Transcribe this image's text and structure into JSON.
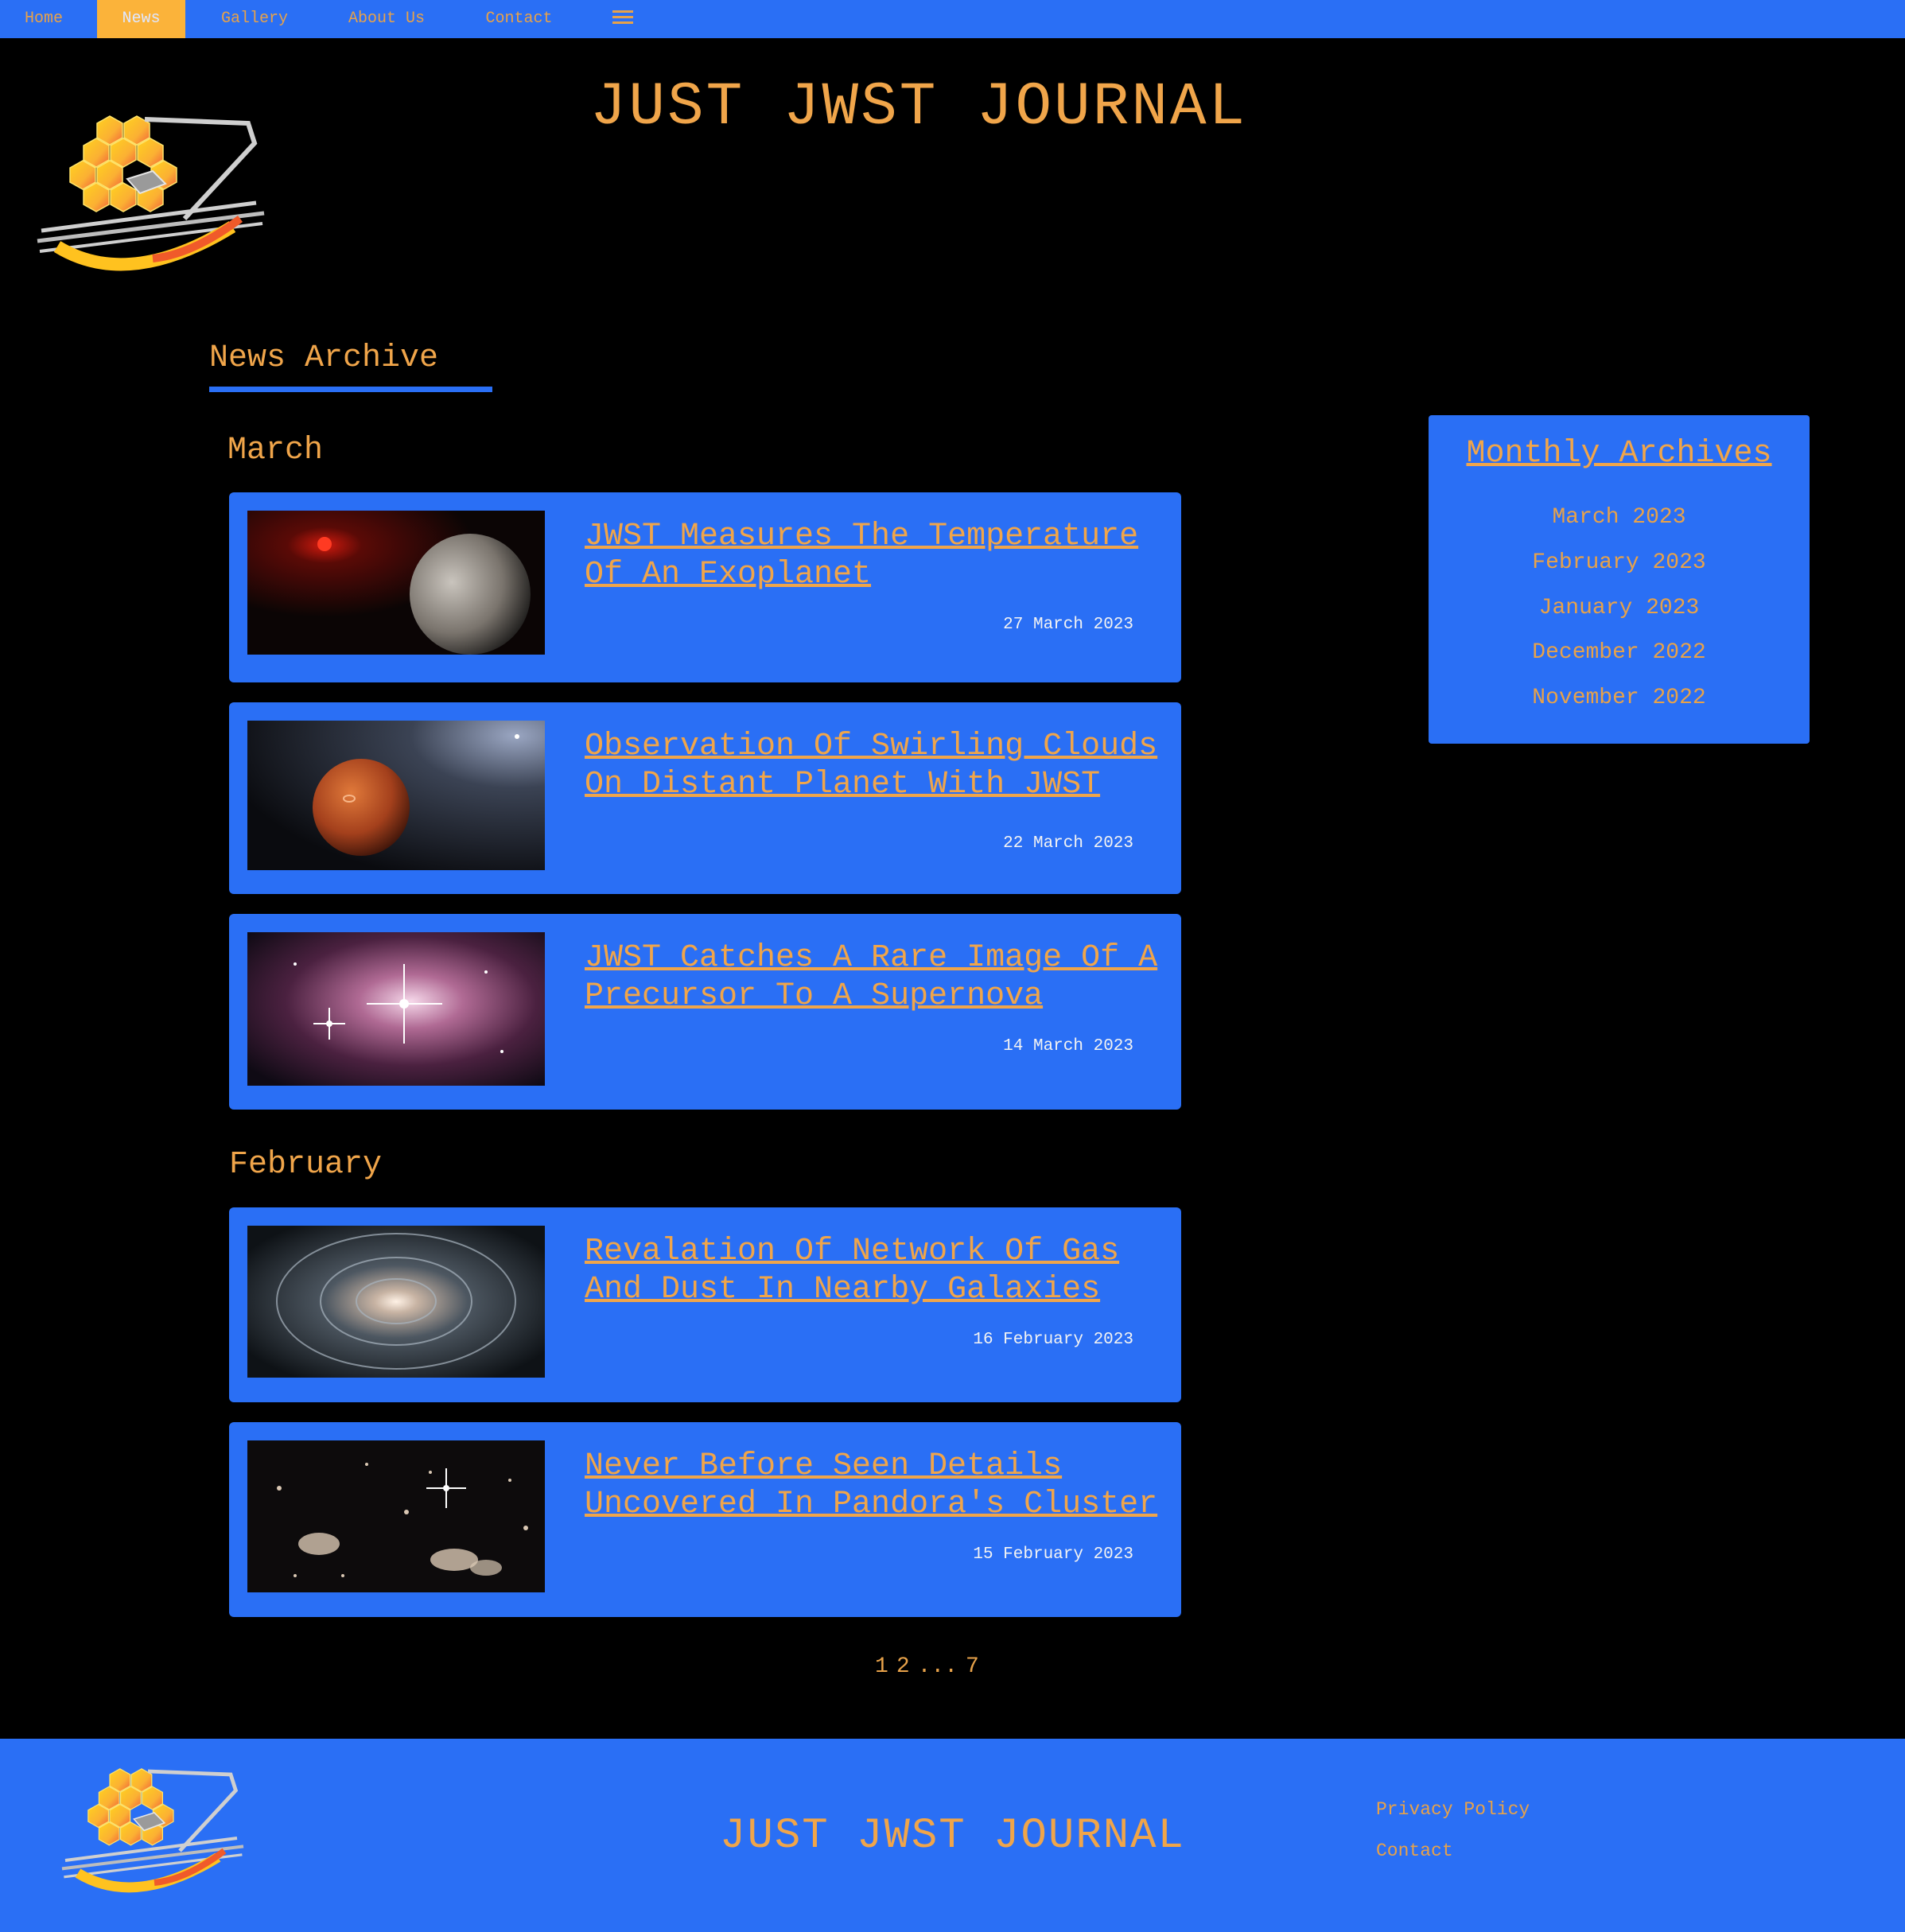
{
  "nav": {
    "items": [
      {
        "label": "Home"
      },
      {
        "label": "News",
        "active": true
      },
      {
        "label": "Gallery"
      },
      {
        "label": "About Us"
      },
      {
        "label": "Contact"
      }
    ],
    "menu_icon": "hamburger-menu-icon"
  },
  "header": {
    "title": "JUST JWST JOURNAL",
    "logo_icon": "jwst-telescope-logo"
  },
  "main": {
    "heading": "News Archive",
    "months": [
      {
        "label": "March",
        "articles": [
          {
            "title": "JWST Measures The Temperature Of An Exoplanet",
            "date": "27 March 2023"
          },
          {
            "title": "Observation Of Swirling Clouds On Distant Planet With JWST",
            "date": "22 March 2023"
          },
          {
            "title": "JWST Catches A Rare Image Of A Precursor To A Supernova",
            "date": "14 March 2023"
          }
        ]
      },
      {
        "label": "February",
        "articles": [
          {
            "title": "Revalation Of Network Of Gas And Dust In Nearby Galaxies",
            "date": "16 February 2023"
          },
          {
            "title": "Never Before Seen Details Uncovered In Pandora's Cluster",
            "date": "15 February 2023"
          }
        ]
      }
    ],
    "pagination": [
      "1",
      "2",
      "...",
      "7"
    ]
  },
  "sidebar": {
    "title": "Monthly Archives",
    "links": [
      "March 2023",
      "February 2023",
      "January 2023",
      "December 2022",
      "November 2022"
    ]
  },
  "footer": {
    "title": "JUST JWST JOURNAL",
    "links": [
      "Privacy Policy",
      "Contact"
    ]
  },
  "colors": {
    "background": "#000000",
    "blue": "#2a6ff5",
    "accent": "#f0a54a",
    "active_tab": "#fbb33a"
  }
}
